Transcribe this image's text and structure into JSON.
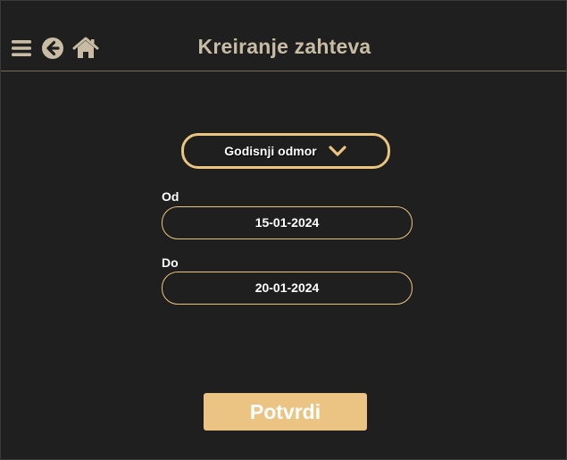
{
  "header": {
    "title": "Kreiranje zahteva",
    "icons": {
      "menu": "hamburger-menu-icon",
      "back": "arrow-left-circle-icon",
      "home": "home-icon"
    }
  },
  "form": {
    "request_type": {
      "value": "Godisnji odmor",
      "icon": "chevron-down-icon"
    },
    "from": {
      "label": "Od",
      "value": "15-01-2024"
    },
    "to": {
      "label": "Do",
      "value": "20-01-2024"
    },
    "submit_label": "Potvrdi"
  },
  "colors": {
    "background": "#1f1f1f",
    "accent": "#ebc47f",
    "title_text": "#c8bca5",
    "icon": "#c8bca5"
  }
}
